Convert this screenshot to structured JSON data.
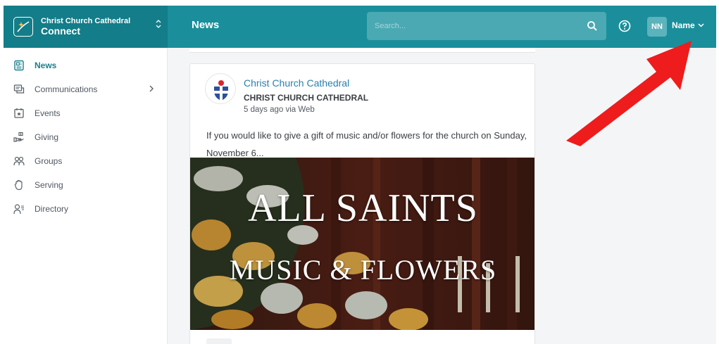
{
  "brand": {
    "org_name": "Christ Church Cathedral",
    "app_name": "Connect"
  },
  "header": {
    "page_title": "News",
    "search_placeholder": "Search...",
    "user_initials": "NN",
    "user_name": "Name"
  },
  "sidebar": {
    "items": [
      {
        "label": "News",
        "icon": "news-icon",
        "active": true
      },
      {
        "label": "Communications",
        "icon": "communications-icon",
        "has_submenu": true
      },
      {
        "label": "Events",
        "icon": "events-icon"
      },
      {
        "label": "Giving",
        "icon": "giving-icon"
      },
      {
        "label": "Groups",
        "icon": "groups-icon"
      },
      {
        "label": "Serving",
        "icon": "serving-icon"
      },
      {
        "label": "Directory",
        "icon": "directory-icon"
      }
    ]
  },
  "post": {
    "author": "Christ Church Cathedral",
    "organization": "CHRIST CHURCH CATHEDRAL",
    "meta": "5 days ago via Web",
    "body": "If you would like to give a gift of music and/or flowers for the church on Sunday, November 6...",
    "image_title_line1": "ALL SAINTS",
    "image_title_line2": "MUSIC & FLOWERS"
  },
  "colors": {
    "header": "#1a8f9b",
    "brand_panel": "#137d89",
    "accent_text": "#1a7f8c",
    "link": "#2a7fae",
    "annotation_arrow": "#ee1c1c"
  }
}
